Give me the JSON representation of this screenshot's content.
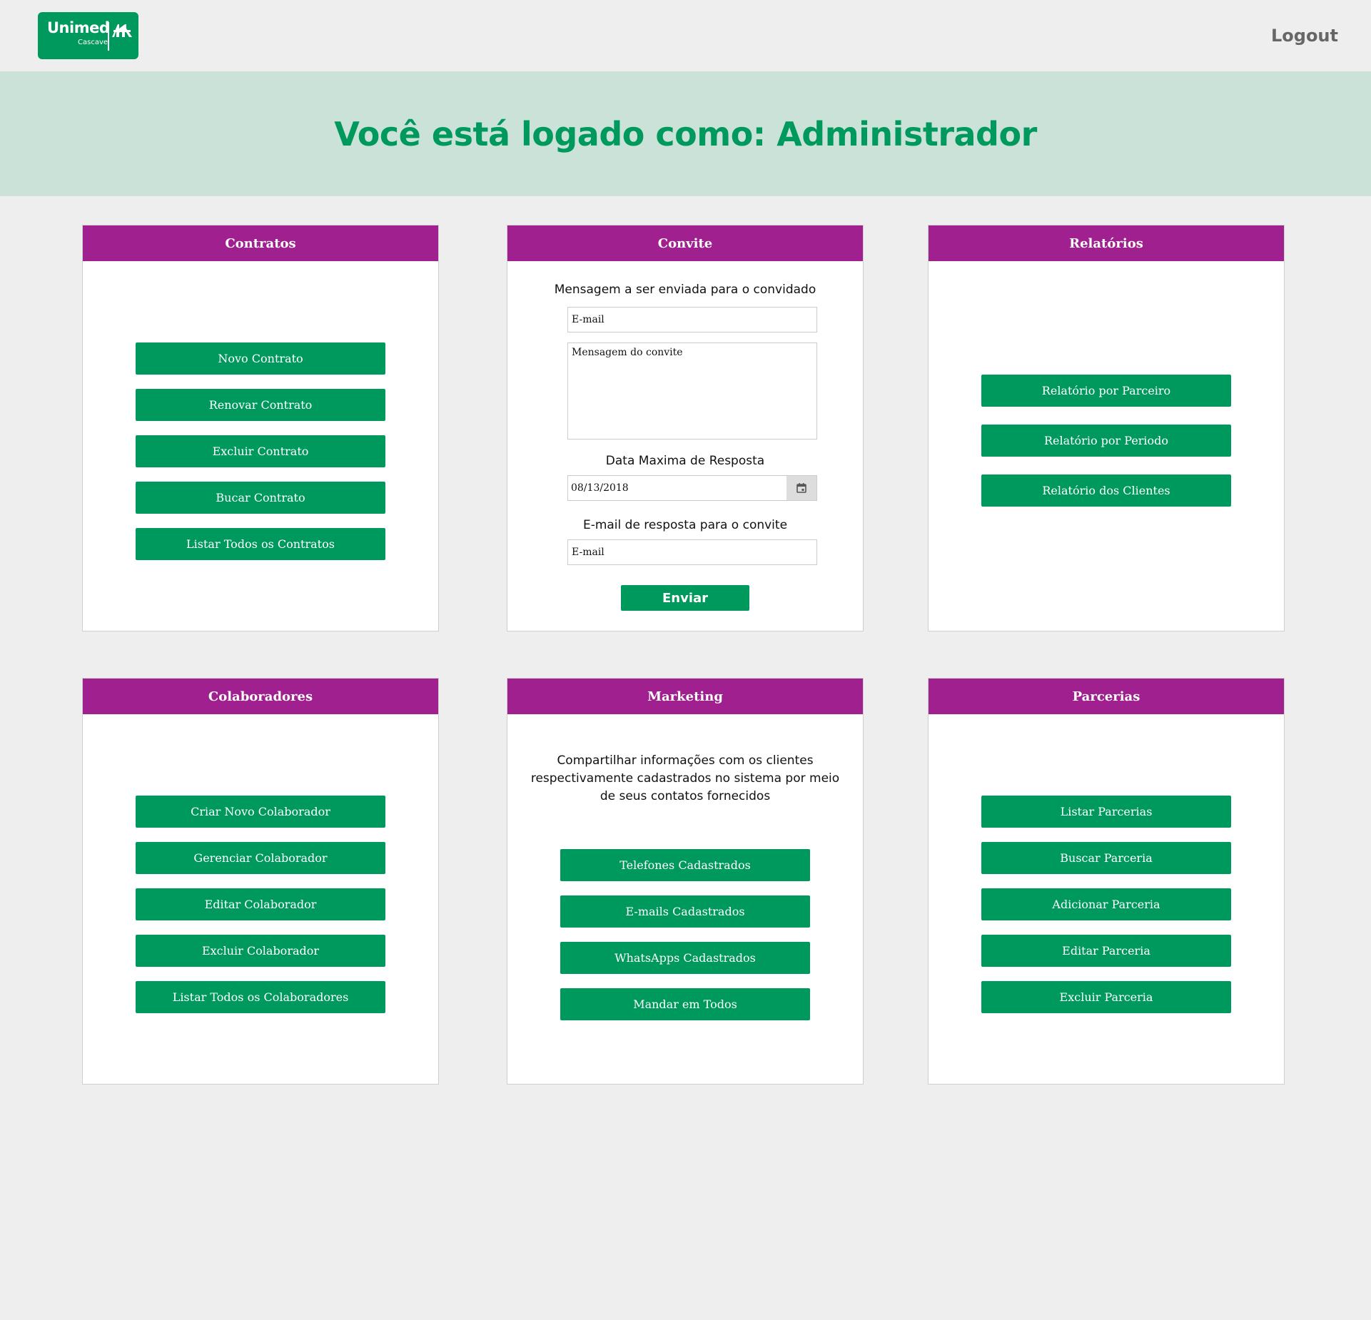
{
  "header": {
    "logo_text": "Unimed",
    "logo_subtext": "Cascavel",
    "logout_label": "Logout"
  },
  "banner": {
    "title": "Você está logado como: Administrador"
  },
  "contratos": {
    "title": "Contratos",
    "buttons": [
      "Novo Contrato",
      "Renovar Contrato",
      "Excluir Contrato",
      "Bucar Contrato",
      "Listar Todos os Contratos"
    ]
  },
  "convite": {
    "title": "Convite",
    "message_label": "Mensagem a ser enviada para o convidado",
    "email_placeholder": "E-mail",
    "message_placeholder": "Mensagem do convite",
    "date_label": "Data Maxima de Resposta",
    "date_value": "08/13/2018",
    "reply_label": "E-mail de resposta para o convite",
    "reply_placeholder": "E-mail",
    "submit_label": "Enviar"
  },
  "relatorios": {
    "title": "Relatórios",
    "buttons": [
      "Relatório por Parceiro",
      "Relatório por Periodo",
      "Relatório dos Clientes"
    ]
  },
  "colaboradores": {
    "title": "Colaboradores",
    "buttons": [
      "Criar Novo Colaborador",
      "Gerenciar Colaborador",
      "Editar Colaborador",
      "Excluir Colaborador",
      "Listar Todos os Colaboradores"
    ]
  },
  "marketing": {
    "title": "Marketing",
    "description": "Compartilhar informações com os clientes respectivamente cadastrados no sistema por meio de seus contatos fornecidos",
    "buttons": [
      "Telefones Cadastrados",
      "E-mails Cadastrados",
      "WhatsApps Cadastrados",
      "Mandar em Todos"
    ]
  },
  "parcerias": {
    "title": "Parcerias",
    "buttons": [
      "Listar Parcerias",
      "Buscar Parceria",
      "Adicionar Parceria",
      "Editar Parceria",
      "Excluir Parceria"
    ]
  },
  "colors": {
    "brand_green": "#00995d",
    "header_purple": "#a0208f",
    "banner_bg": "#cbe2d9"
  }
}
